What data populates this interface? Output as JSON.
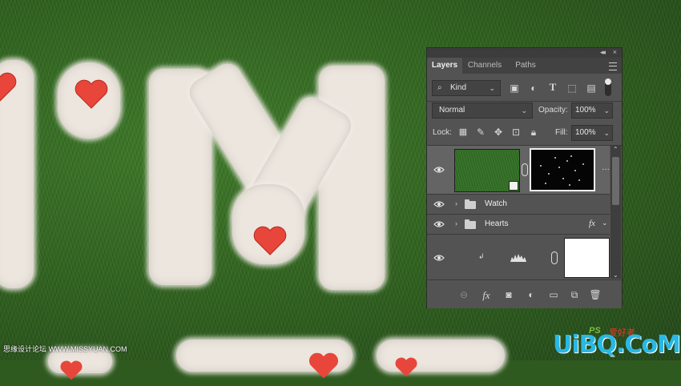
{
  "panel": {
    "tabs": [
      "Layers",
      "Channels",
      "Paths"
    ],
    "active_tab": "Layers",
    "filter": {
      "kind_label": "Kind"
    },
    "blend": {
      "mode": "Normal",
      "opacity_label": "Opacity:",
      "opacity_value": "100%"
    },
    "lock": {
      "label": "Lock:",
      "fill_label": "Fill:",
      "fill_value": "100%"
    },
    "layers": [
      {
        "type": "grass-smart-object-with-mask",
        "selected": true
      },
      {
        "type": "group",
        "name": "Watch"
      },
      {
        "type": "group",
        "name": "Hearts",
        "fx": "fx"
      },
      {
        "type": "levels-adjustment-clipped"
      }
    ],
    "footer_icons": [
      "link-icon",
      "fx-icon",
      "mask-icon",
      "adjustment-icon",
      "folder-icon",
      "new-layer-icon",
      "trash-icon"
    ]
  },
  "colors": {
    "panel_bg": "#535353",
    "panel_dark": "#424242",
    "accent_brand": "#27b8e6",
    "heart_red": "#e8463a"
  },
  "watermark": {
    "left": "思缘设计论坛 WWW.MISSYUAN.COM",
    "right": "UiBQ.CoM",
    "ps": "PS",
    "ps_cn": "爱好者"
  }
}
